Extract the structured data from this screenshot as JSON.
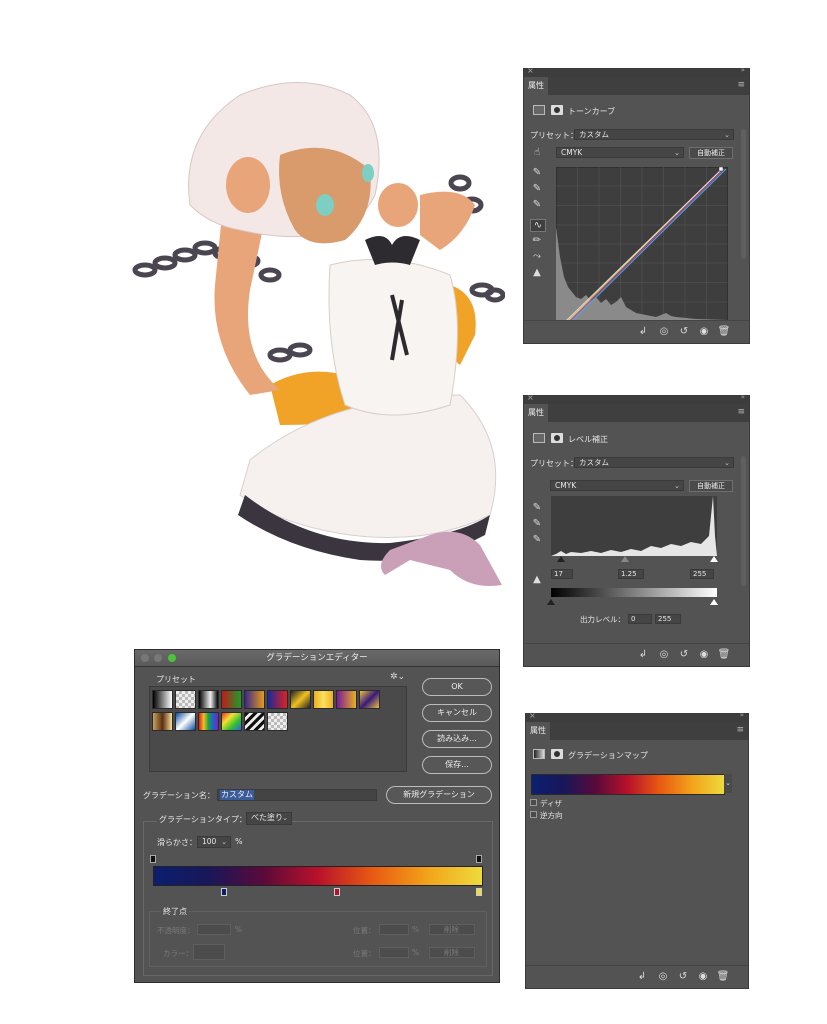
{
  "curves_panel": {
    "tab": "属性",
    "title": "トーンカーブ",
    "preset_label": "プリセット：",
    "preset_value": "カスタム",
    "channel_value": "CMYK",
    "auto_label": "自動補正"
  },
  "levels_panel": {
    "tab": "属性",
    "title": "レベル補正",
    "preset_label": "プリセット：",
    "preset_value": "カスタム",
    "channel_value": "CMYK",
    "auto_label": "自動補正",
    "input_black": "17",
    "input_gamma": "1.25",
    "input_white": "255",
    "output_label": "出力レベル：",
    "output_black": "0",
    "output_white": "255"
  },
  "gradmap_panel": {
    "tab": "属性",
    "title": "グラデーションマップ",
    "dither_label": "ディザ",
    "reverse_label": "逆方向",
    "dither_checked": false,
    "reverse_checked": false
  },
  "gradient_editor": {
    "window_title": "グラデーションエディター",
    "presets_label": "プリセット",
    "ok_label": "OK",
    "cancel_label": "キャンセル",
    "load_label": "読み込み...",
    "save_label": "保存...",
    "name_label": "グラデーション名：",
    "name_value": "カスタム",
    "new_gradient_label": "新規グラデーション",
    "type_label": "グラデーションタイプ：",
    "type_value": "べた塗り",
    "smoothness_label": "滑らかさ：",
    "smoothness_value": "100",
    "smoothness_unit": "%",
    "stops_group_label": "終了点",
    "opacity_label": "不透明度：",
    "opacity_unit": "%",
    "location_label": "位置：",
    "location_unit": "%",
    "delete_label": "削除",
    "color_label": "カラー：",
    "gradient_colors": [
      "#0b1f6e",
      "#18175a",
      "#5a0a3a",
      "#b8122a",
      "#e85a12",
      "#f2a31a",
      "#eedb3c"
    ]
  },
  "colors": {
    "panel_bg": "#535353",
    "panel_dark": "#3d3d3d",
    "selection_blue": "#3b5b9b"
  }
}
